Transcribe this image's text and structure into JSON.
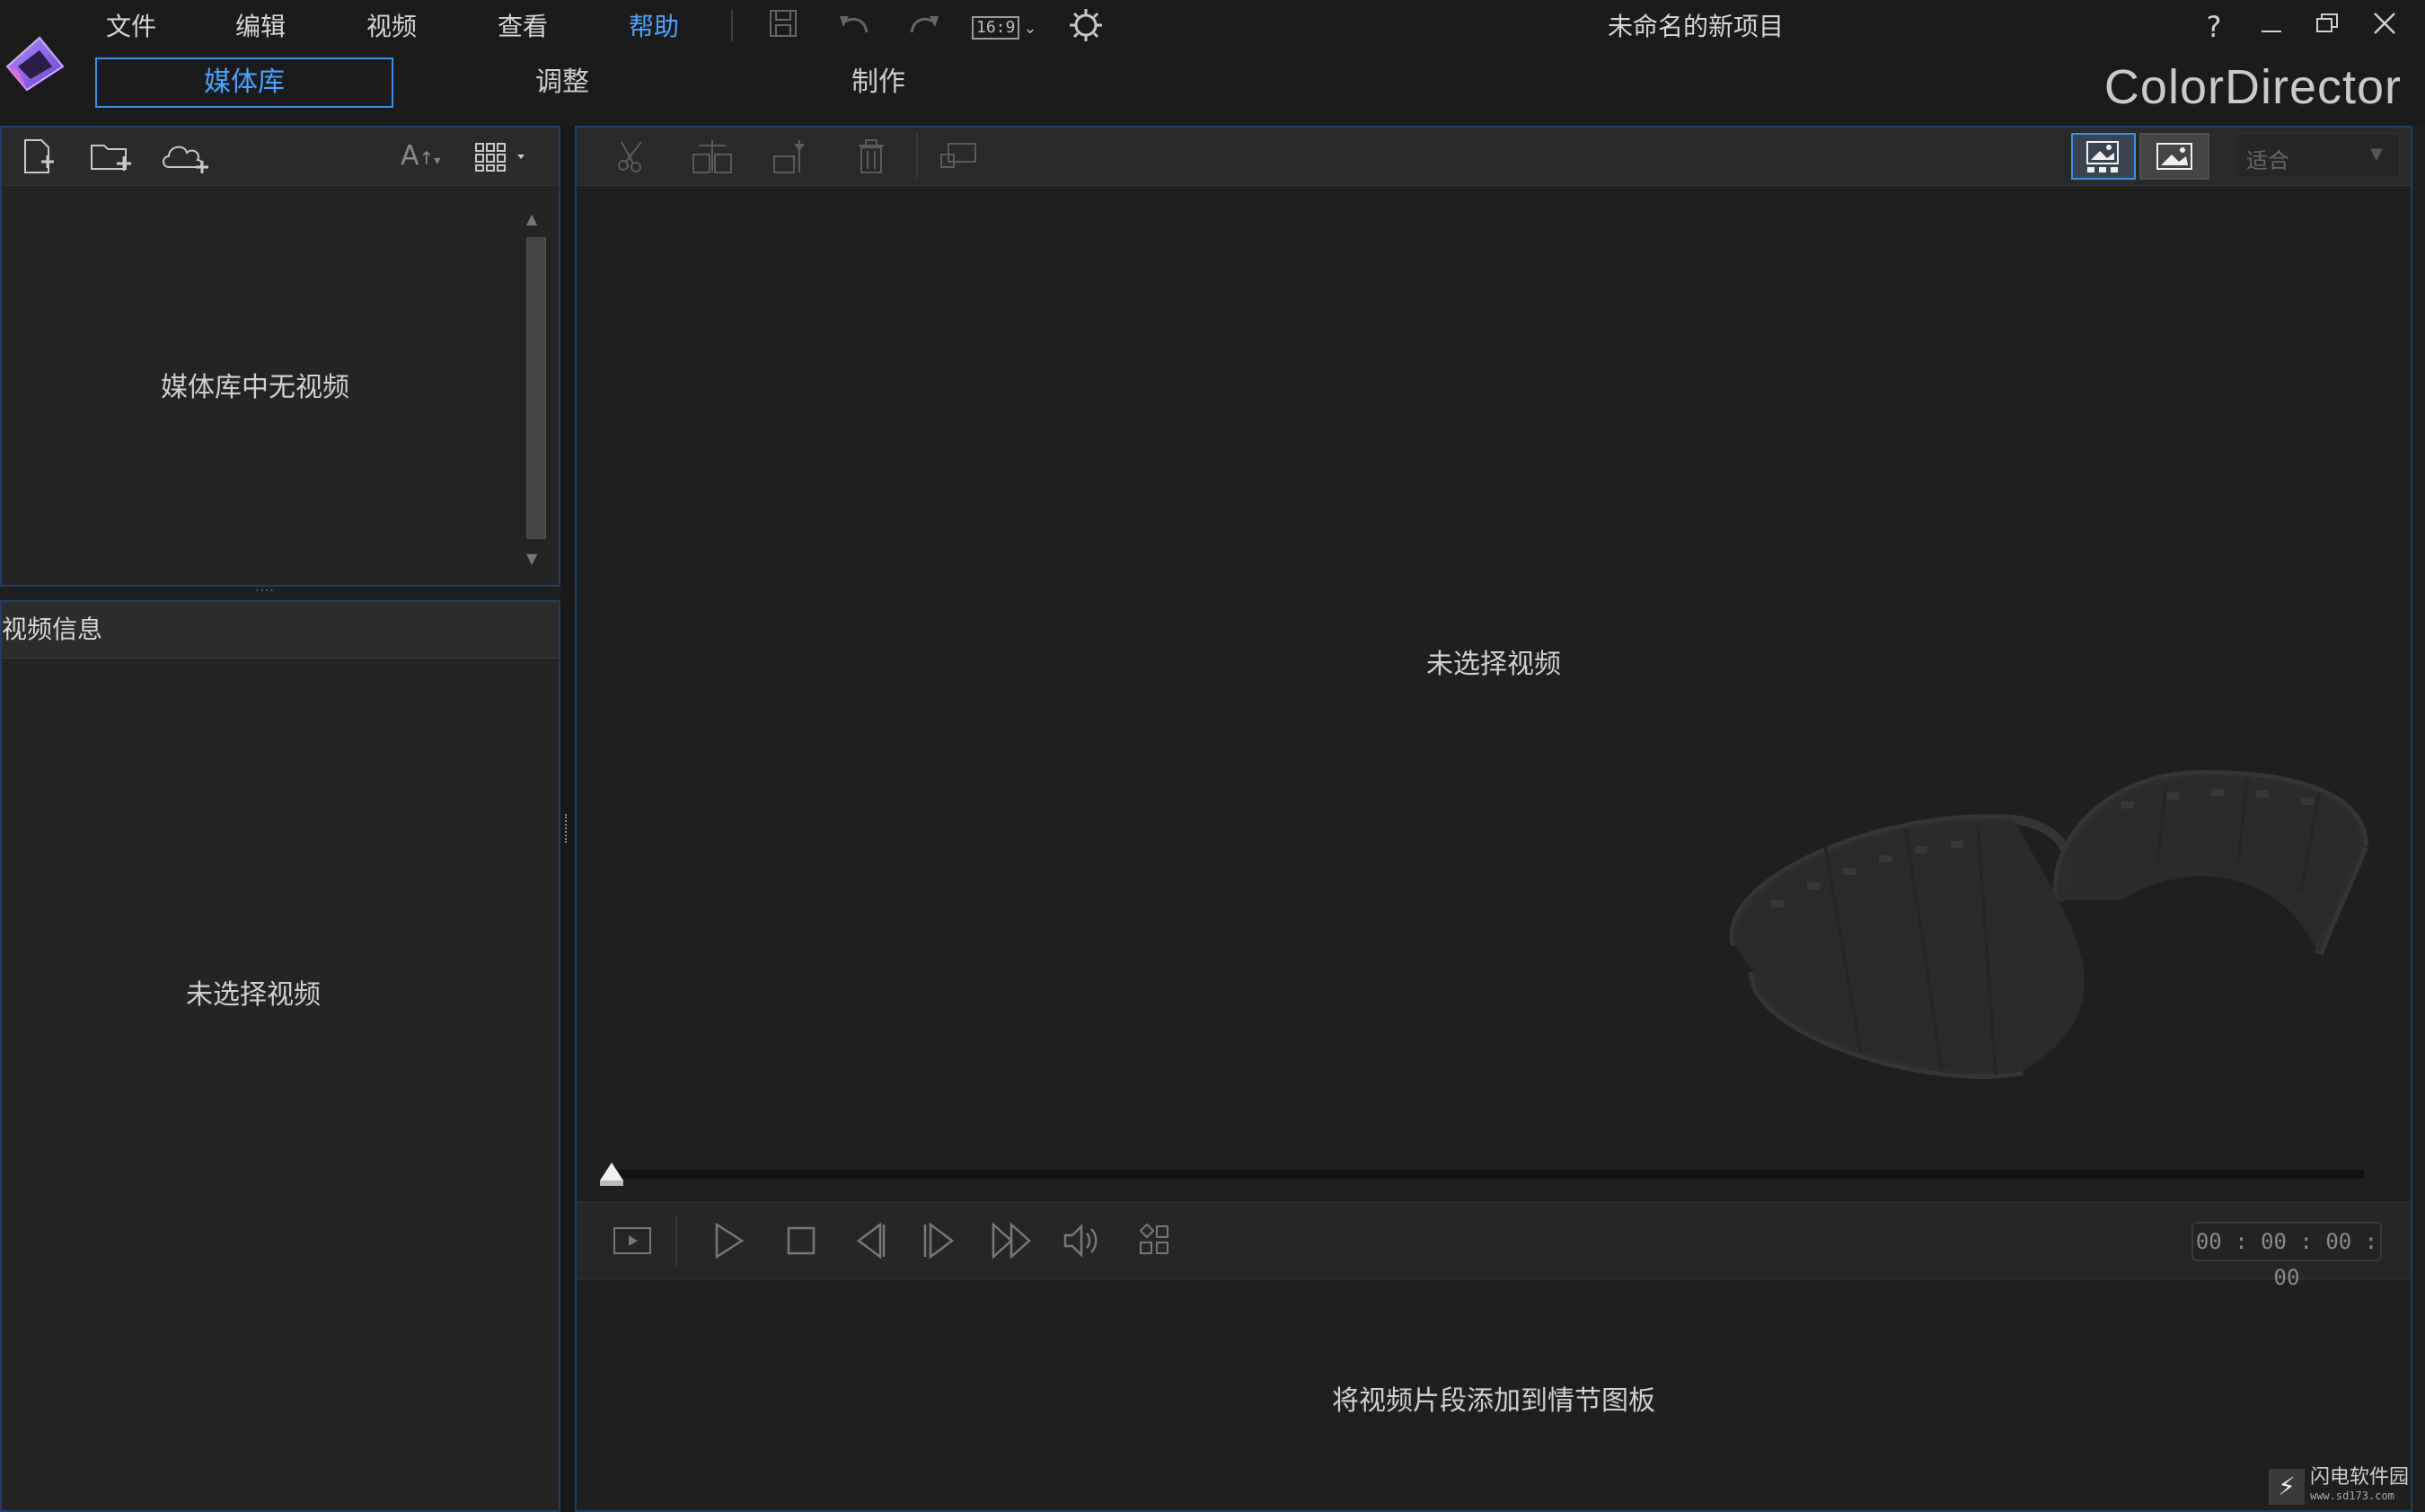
{
  "app": {
    "title": "未命名的新项目",
    "brand": "ColorDirector"
  },
  "menu": [
    {
      "label": "文件",
      "active": false
    },
    {
      "label": "编辑",
      "active": false
    },
    {
      "label": "视频",
      "active": false
    },
    {
      "label": "查看",
      "active": false
    },
    {
      "label": "帮助",
      "active": true
    }
  ],
  "toolbar": {
    "aspect_ratio": "16:9"
  },
  "window_controls": {
    "help": "?"
  },
  "tabs": [
    {
      "label": "媒体库",
      "active": true
    },
    {
      "label": "调整",
      "active": false
    },
    {
      "label": "制作",
      "active": false
    }
  ],
  "media_library": {
    "empty_text": "媒体库中无视频"
  },
  "video_info": {
    "title": "视频信息",
    "empty_text": "未选择视频"
  },
  "preview": {
    "zoom_value": "适合",
    "empty_text": "未选择视频",
    "timecode": "00 : 00 : 00 : 00",
    "playhead_position": 0
  },
  "storyboard": {
    "empty_text": "将视频片段添加到情节图板"
  },
  "watermark": {
    "name": "闪电软件园",
    "url": "www.sd173.com"
  },
  "colors": {
    "accent": "#4aa3ff",
    "panel_border": "#1d3f6a",
    "background": "#1e1e1e"
  }
}
